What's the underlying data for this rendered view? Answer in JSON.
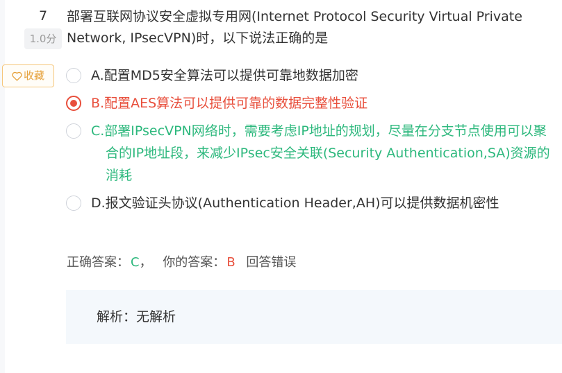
{
  "question": {
    "number": "7",
    "score": "1.0分",
    "stem": "部署互联网协议安全虚拟专用网(Internet Protocol Security Virtual Private Network, IPsecVPN)时，以下说法正确的是"
  },
  "favorite": {
    "label": "收藏",
    "icon": "heart-outline-icon",
    "color": "#e6a23c"
  },
  "options": [
    {
      "text": "A.配置MD5安全算法可以提供可靠地数据加密",
      "state": "unselected",
      "color": "#333333"
    },
    {
      "text": "B.配置AES算法可以提供可靠的数据完整性验证",
      "state": "selected-wrong",
      "color": "#e84f3c"
    },
    {
      "text": "C.部署IPsecVPN网络时，需要考虑IP地址的规划，尽量在分支节点使用可以聚合的IP地址段，来减少IPsec安全关联(Security Authentication,SA)资源的消耗",
      "state": "correct",
      "color": "#2db87d"
    },
    {
      "text": "D.报文验证头协议(Authentication Header,AH)可以提供数据机密性",
      "state": "unselected",
      "color": "#333333"
    }
  ],
  "result": {
    "correct_label": "正确答案：",
    "correct_value": "C",
    "separator": "，",
    "mine_label": "你的答案：",
    "mine_value": "B",
    "verdict": "回答错误"
  },
  "analysis": {
    "label": "解析：",
    "text": "无解析"
  }
}
